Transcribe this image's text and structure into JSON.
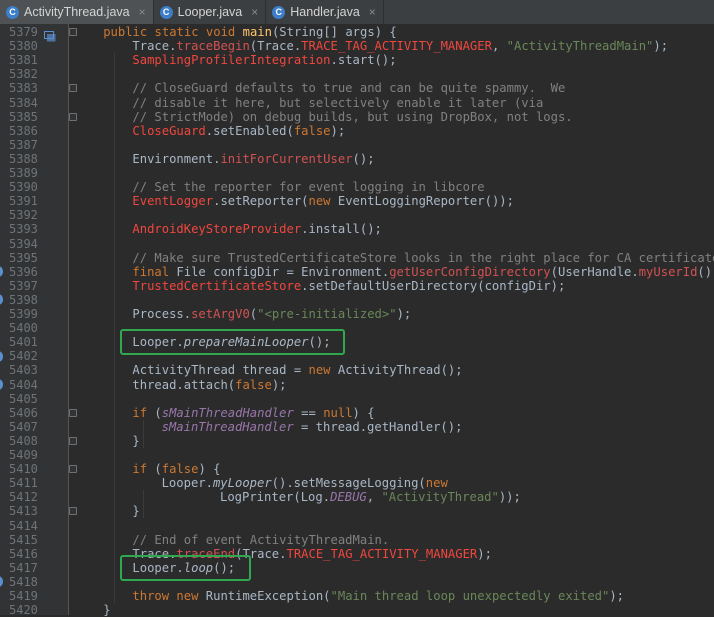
{
  "tabs": [
    {
      "label": "ActivityThread.java",
      "icon": "class-icon",
      "active": true
    },
    {
      "label": "Looper.java",
      "icon": "class-icon",
      "active": false
    },
    {
      "label": "Handler.java",
      "icon": "class-icon",
      "active": false
    }
  ],
  "close_glyph": "×",
  "class_glyph": "C",
  "colors": {
    "editor_bg": "#2b2b2b",
    "gutter_bg": "#313335",
    "keyword": "#cc7832",
    "string": "#6a8759",
    "comment": "#808080",
    "highlight_box": "#2fa84f"
  },
  "lines": [
    {
      "n": "5379",
      "indent": 1,
      "tokens": [
        [
          "kw",
          "public static void "
        ],
        [
          "fn",
          "main"
        ],
        [
          "plain",
          "(String[] args) {"
        ]
      ]
    },
    {
      "n": "5380",
      "indent": 2,
      "tokens": [
        [
          "plain",
          "Trace."
        ],
        [
          "call",
          "traceBegin"
        ],
        [
          "plain",
          "(Trace."
        ],
        [
          "red",
          "TRACE_TAG_ACTIVITY_MANAGER"
        ],
        [
          "plain",
          ", "
        ],
        [
          "str",
          "\"ActivityThreadMain\""
        ],
        [
          "plain",
          ");"
        ]
      ]
    },
    {
      "n": "5381",
      "indent": 2,
      "tokens": [
        [
          "red",
          "SamplingProfilerIntegration"
        ],
        [
          "plain",
          ".start();"
        ]
      ]
    },
    {
      "n": "5382",
      "indent": 0,
      "tokens": []
    },
    {
      "n": "5383",
      "indent": 2,
      "tokens": [
        [
          "cm",
          "// CloseGuard defaults to true and can be quite spammy.  We"
        ]
      ]
    },
    {
      "n": "5384",
      "indent": 2,
      "tokens": [
        [
          "cm",
          "// disable it here, but selectively enable it later (via"
        ]
      ]
    },
    {
      "n": "5385",
      "indent": 2,
      "tokens": [
        [
          "cm",
          "// StrictMode) on debug builds, but using DropBox, not logs."
        ]
      ]
    },
    {
      "n": "5386",
      "indent": 2,
      "tokens": [
        [
          "red",
          "CloseGuard"
        ],
        [
          "plain",
          ".setEnabled("
        ],
        [
          "kw",
          "false"
        ],
        [
          "plain",
          ");"
        ]
      ]
    },
    {
      "n": "5387",
      "indent": 0,
      "tokens": []
    },
    {
      "n": "5388",
      "indent": 2,
      "tokens": [
        [
          "plain",
          "Environment."
        ],
        [
          "call",
          "initForCurrentUser"
        ],
        [
          "plain",
          "();"
        ]
      ]
    },
    {
      "n": "5389",
      "indent": 0,
      "tokens": []
    },
    {
      "n": "5390",
      "indent": 2,
      "tokens": [
        [
          "cm",
          "// Set the reporter for event logging in libcore"
        ]
      ]
    },
    {
      "n": "5391",
      "indent": 2,
      "tokens": [
        [
          "red",
          "EventLogger"
        ],
        [
          "plain",
          ".setReporter("
        ],
        [
          "kw",
          "new "
        ],
        [
          "plain",
          "EventLoggingReporter());"
        ]
      ]
    },
    {
      "n": "5392",
      "indent": 0,
      "tokens": []
    },
    {
      "n": "5393",
      "indent": 2,
      "tokens": [
        [
          "red",
          "AndroidKeyStoreProvider"
        ],
        [
          "plain",
          ".install();"
        ]
      ]
    },
    {
      "n": "5394",
      "indent": 0,
      "tokens": []
    },
    {
      "n": "5395",
      "indent": 2,
      "tokens": [
        [
          "cm",
          "// Make sure TrustedCertificateStore looks in the right place for CA certificates"
        ]
      ]
    },
    {
      "n": "5396",
      "indent": 2,
      "tokens": [
        [
          "kw",
          "final "
        ],
        [
          "plain",
          "File configDir = Environment."
        ],
        [
          "call",
          "getUserConfigDirectory"
        ],
        [
          "plain",
          "(UserHandle."
        ],
        [
          "call",
          "myUserId"
        ],
        [
          "plain",
          "());"
        ]
      ]
    },
    {
      "n": "5397",
      "indent": 2,
      "tokens": [
        [
          "red",
          "TrustedCertificateStore"
        ],
        [
          "plain",
          ".setDefaultUserDirectory(configDir);"
        ]
      ]
    },
    {
      "n": "5398",
      "indent": 0,
      "tokens": []
    },
    {
      "n": "5399",
      "indent": 2,
      "tokens": [
        [
          "plain",
          "Process."
        ],
        [
          "call",
          "setArgV0"
        ],
        [
          "plain",
          "("
        ],
        [
          "str",
          "\"<pre-initialized>\""
        ],
        [
          "plain",
          ");"
        ]
      ]
    },
    {
      "n": "5400",
      "indent": 0,
      "tokens": []
    },
    {
      "n": "5401",
      "indent": 2,
      "tokens": [
        [
          "plain",
          "Looper."
        ],
        [
          "itd",
          "prepareMainLooper"
        ],
        [
          "plain",
          "();"
        ]
      ]
    },
    {
      "n": "5402",
      "indent": 0,
      "tokens": []
    },
    {
      "n": "5403",
      "indent": 2,
      "tokens": [
        [
          "plain",
          "ActivityThread thread = "
        ],
        [
          "kw",
          "new "
        ],
        [
          "plain",
          "ActivityThread();"
        ]
      ]
    },
    {
      "n": "5404",
      "indent": 2,
      "tokens": [
        [
          "plain",
          "thread.attach("
        ],
        [
          "kw",
          "false"
        ],
        [
          "plain",
          ");"
        ]
      ]
    },
    {
      "n": "5405",
      "indent": 0,
      "tokens": []
    },
    {
      "n": "5406",
      "indent": 2,
      "tokens": [
        [
          "kw",
          "if "
        ],
        [
          "plain",
          "("
        ],
        [
          "it",
          "sMainThreadHandler"
        ],
        [
          "plain",
          " == "
        ],
        [
          "kw",
          "null"
        ],
        [
          "plain",
          ") {"
        ]
      ]
    },
    {
      "n": "5407",
      "indent": 3,
      "tokens": [
        [
          "it",
          "sMainThreadHandler"
        ],
        [
          "plain",
          " = thread.getHandler();"
        ]
      ]
    },
    {
      "n": "5408",
      "indent": 2,
      "tokens": [
        [
          "plain",
          "}"
        ]
      ]
    },
    {
      "n": "5409",
      "indent": 0,
      "tokens": []
    },
    {
      "n": "5410",
      "indent": 2,
      "tokens": [
        [
          "kw",
          "if "
        ],
        [
          "plain",
          "("
        ],
        [
          "kw",
          "false"
        ],
        [
          "plain",
          ") {"
        ]
      ]
    },
    {
      "n": "5411",
      "indent": 3,
      "tokens": [
        [
          "plain",
          "Looper."
        ],
        [
          "itd",
          "myLooper"
        ],
        [
          "plain",
          "().setMessageLogging("
        ],
        [
          "kw",
          "new"
        ]
      ]
    },
    {
      "n": "5412",
      "indent": 5,
      "tokens": [
        [
          "plain",
          "LogPrinter(Log."
        ],
        [
          "it",
          "DEBUG"
        ],
        [
          "plain",
          ", "
        ],
        [
          "str",
          "\"ActivityThread\""
        ],
        [
          "plain",
          "));"
        ]
      ]
    },
    {
      "n": "5413",
      "indent": 2,
      "tokens": [
        [
          "plain",
          "}"
        ]
      ]
    },
    {
      "n": "5414",
      "indent": 0,
      "tokens": []
    },
    {
      "n": "5415",
      "indent": 2,
      "tokens": [
        [
          "cm",
          "// End of event ActivityThreadMain."
        ]
      ]
    },
    {
      "n": "5416",
      "indent": 2,
      "tokens": [
        [
          "plain",
          "Trace."
        ],
        [
          "call",
          "traceEnd"
        ],
        [
          "plain",
          "(Trace."
        ],
        [
          "red",
          "TRACE_TAG_ACTIVITY_MANAGER"
        ],
        [
          "plain",
          ");"
        ]
      ]
    },
    {
      "n": "5417",
      "indent": 2,
      "tokens": [
        [
          "plain",
          "Looper."
        ],
        [
          "itd",
          "loop"
        ],
        [
          "plain",
          "();"
        ]
      ]
    },
    {
      "n": "5418",
      "indent": 0,
      "tokens": []
    },
    {
      "n": "5419",
      "indent": 2,
      "tokens": [
        [
          "kw",
          "throw new "
        ],
        [
          "plain",
          "RuntimeException("
        ],
        [
          "str",
          "\"Main thread loop unexpectedly exited\""
        ],
        [
          "plain",
          ");"
        ]
      ]
    },
    {
      "n": "5420",
      "indent": 1,
      "tokens": [
        [
          "plain",
          "}"
        ]
      ]
    }
  ],
  "highlighted_lines": [
    "5401",
    "5417"
  ]
}
